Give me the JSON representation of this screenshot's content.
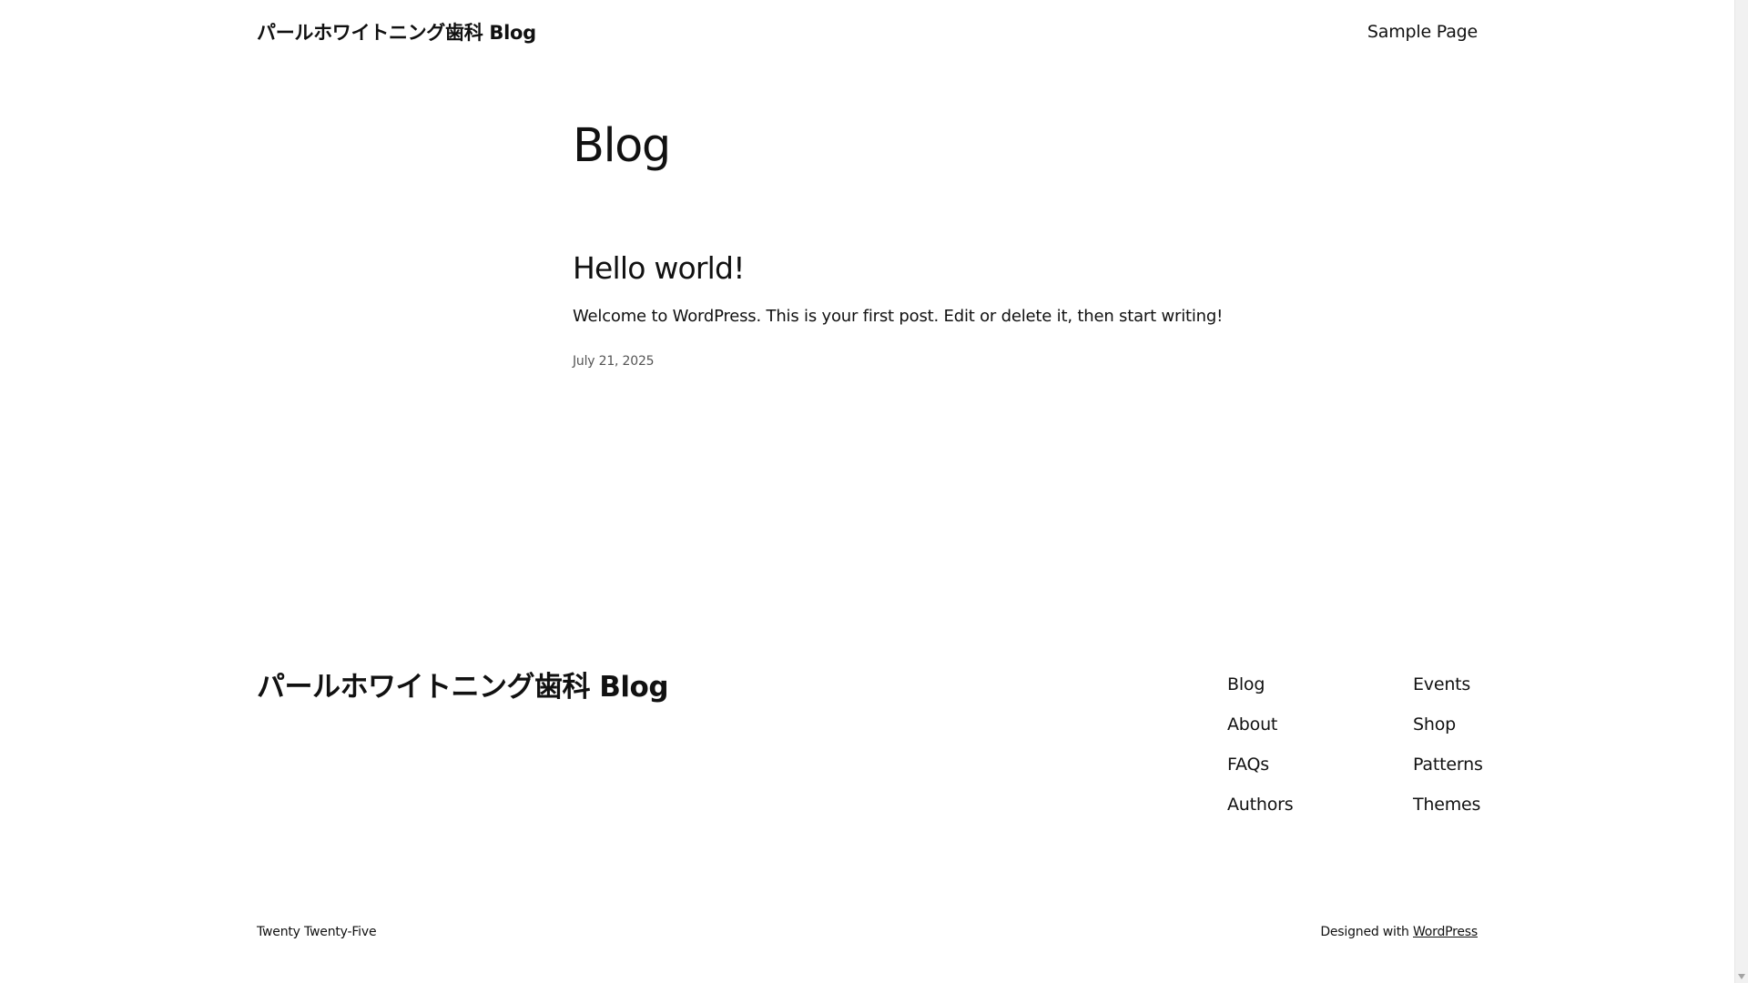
{
  "header": {
    "site_title": "パールホワイトニング歯科 Blog",
    "nav": [
      {
        "label": "Sample Page"
      }
    ]
  },
  "main": {
    "page_title": "Blog",
    "posts": [
      {
        "title": "Hello world!",
        "excerpt": "Welcome to WordPress. This is your first post. Edit or delete it, then start writing!",
        "date": "July 21, 2025"
      }
    ]
  },
  "footer": {
    "site_title": "パールホワイトニング歯科 Blog",
    "column_1": [
      {
        "label": "Blog"
      },
      {
        "label": "About"
      },
      {
        "label": "FAQs"
      },
      {
        "label": "Authors"
      }
    ],
    "column_2": [
      {
        "label": "Events"
      },
      {
        "label": "Shop"
      },
      {
        "label": "Patterns"
      },
      {
        "label": "Themes"
      }
    ],
    "theme_name": "Twenty Twenty-Five",
    "credit_prefix": "Designed with",
    "credit_link": "WordPress"
  },
  "icons": {
    "scroll_down": "chevron-down-icon"
  }
}
